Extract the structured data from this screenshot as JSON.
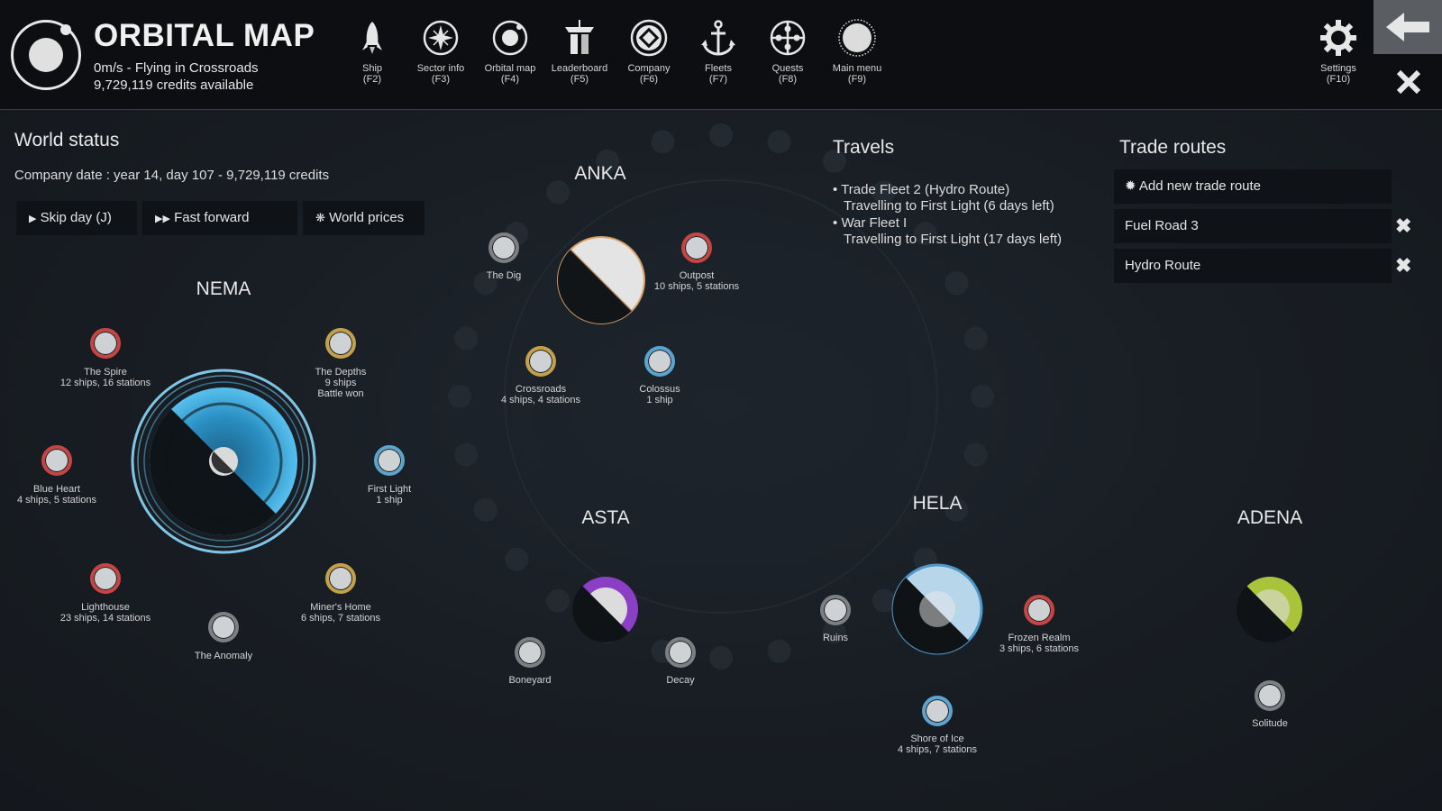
{
  "header": {
    "title": "ORBITAL MAP",
    "status_speed": "0m/s - Flying in Crossroads",
    "status_credits": "9,729,119 credits available"
  },
  "nav": [
    {
      "label": "Ship",
      "key": "(F2)",
      "icon": "rocket-icon"
    },
    {
      "label": "Sector info",
      "key": "(F3)",
      "icon": "compass-star-icon"
    },
    {
      "label": "Orbital map",
      "key": "(F4)",
      "icon": "orbit-icon"
    },
    {
      "label": "Leaderboard",
      "key": "(F5)",
      "icon": "podium-icon"
    },
    {
      "label": "Company",
      "key": "(F6)",
      "icon": "company-emblem-icon"
    },
    {
      "label": "Fleets",
      "key": "(F7)",
      "icon": "anchor-icon"
    },
    {
      "label": "Quests",
      "key": "(F8)",
      "icon": "crosshair-icon"
    },
    {
      "label": "Main menu",
      "key": "(F9)",
      "icon": "planet-menu-icon"
    }
  ],
  "settings": {
    "label": "Settings",
    "key": "(F10)"
  },
  "world_status": {
    "title": "World status",
    "date": "Company date : year 14, day 107 - 9,729,119 credits",
    "buttons": [
      "Skip day (J)",
      "Fast forward",
      "World prices"
    ]
  },
  "travels": {
    "title": "Travels",
    "items": [
      {
        "name": "Trade Fleet 2 (Hydro Route)",
        "status": "Travelling to First Light (6 days left)"
      },
      {
        "name": "War Fleet I",
        "status": "Travelling to First Light (17 days left)"
      }
    ]
  },
  "trade_routes": {
    "title": "Trade routes",
    "add_label": "Add new trade route",
    "routes": [
      "Fuel Road 3",
      "Hydro Route"
    ]
  },
  "systems": {
    "nema": {
      "name": "NEMA",
      "nodes": [
        {
          "name": "The Spire",
          "info1": "12 ships, 16 stations",
          "info2": ""
        },
        {
          "name": "The Depths",
          "info1": "9 ships",
          "info2": "Battle won"
        },
        {
          "name": "Blue Heart",
          "info1": "4 ships, 5 stations",
          "info2": ""
        },
        {
          "name": "First Light",
          "info1": "1 ship",
          "info2": ""
        },
        {
          "name": "Lighthouse",
          "info1": "23 ships, 14 stations",
          "info2": ""
        },
        {
          "name": "Miner's Home",
          "info1": "6 ships, 7 stations",
          "info2": ""
        },
        {
          "name": "The Anomaly",
          "info1": "",
          "info2": ""
        }
      ]
    },
    "anka": {
      "name": "ANKA",
      "nodes": [
        {
          "name": "The Dig",
          "info1": ""
        },
        {
          "name": "Outpost",
          "info1": "10 ships, 5 stations"
        },
        {
          "name": "Crossroads",
          "info1": "4 ships, 4 stations"
        },
        {
          "name": "Colossus",
          "info1": "1 ship"
        }
      ]
    },
    "asta": {
      "name": "ASTA",
      "nodes": [
        {
          "name": "Boneyard",
          "info1": ""
        },
        {
          "name": "Decay",
          "info1": ""
        }
      ]
    },
    "hela": {
      "name": "HELA",
      "nodes": [
        {
          "name": "Ruins",
          "info1": ""
        },
        {
          "name": "Frozen Realm",
          "info1": "3 ships, 6 stations"
        },
        {
          "name": "Shore of Ice",
          "info1": "4 ships, 7 stations"
        }
      ]
    },
    "adena": {
      "name": "ADENA",
      "nodes": [
        {
          "name": "Solitude",
          "info1": ""
        }
      ]
    }
  },
  "colors": {
    "hostile": "#c84444",
    "neutral_trade": "#c4a04a",
    "friendly": "#5aa5cf",
    "unowned": "#7c8084"
  }
}
